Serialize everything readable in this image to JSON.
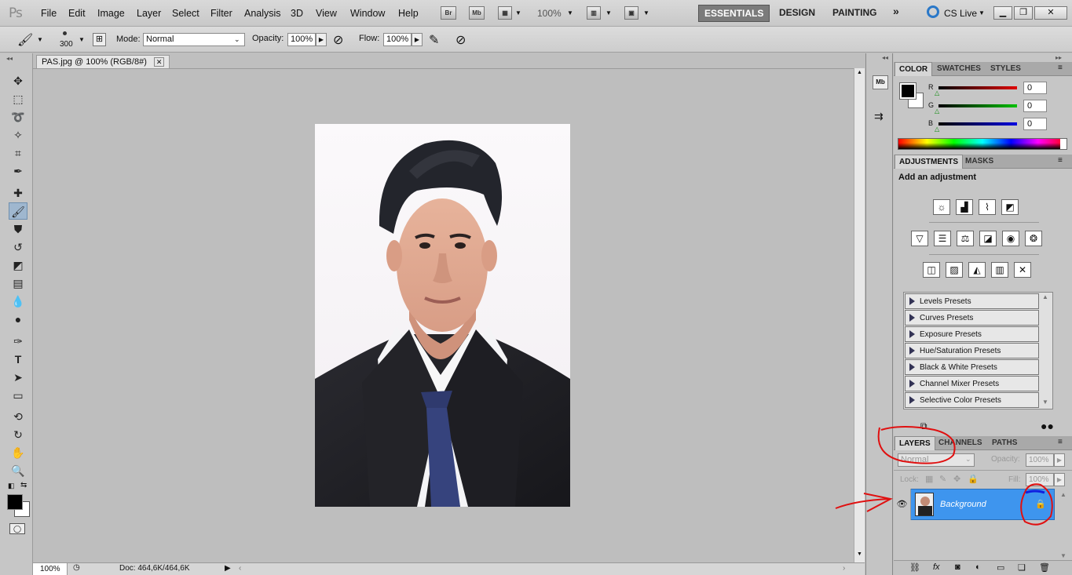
{
  "menubar": {
    "logo": "Ps",
    "items": [
      "File",
      "Edit",
      "Image",
      "Layer",
      "Select",
      "Filter",
      "Analysis",
      "3D",
      "View",
      "Window",
      "Help"
    ],
    "bridge": "Br",
    "minibridge": "Mb",
    "zoom": "100%",
    "workspaces": [
      "ESSENTIALS",
      "DESIGN",
      "PAINTING"
    ],
    "more": "»",
    "cslive": "CS Live"
  },
  "options": {
    "brush_size": "300",
    "mode_label": "Mode:",
    "mode_value": "Normal",
    "opacity_label": "Opacity:",
    "opacity_value": "100%",
    "flow_label": "Flow:",
    "flow_value": "100%"
  },
  "document": {
    "tab_title": "PAS.jpg @ 100% (RGB/8#)",
    "zoom": "100%",
    "doc_info": "Doc: 464,6K/464,6K"
  },
  "color_panel": {
    "tabs": [
      "COLOR",
      "SWATCHES",
      "STYLES"
    ],
    "channels": [
      {
        "label": "R",
        "value": "0",
        "color": "#d00000"
      },
      {
        "label": "G",
        "value": "0",
        "color": "#00b000"
      },
      {
        "label": "B",
        "value": "0",
        "color": "#0000d0"
      }
    ]
  },
  "adjustments_panel": {
    "tabs": [
      "ADJUSTMENTS",
      "MASKS"
    ],
    "heading": "Add an adjustment",
    "presets": [
      "Levels Presets",
      "Curves Presets",
      "Exposure Presets",
      "Hue/Saturation Presets",
      "Black & White Presets",
      "Channel Mixer Presets",
      "Selective Color Presets"
    ]
  },
  "layers_panel": {
    "tabs": [
      "LAYERS",
      "CHANNELS",
      "PATHS"
    ],
    "blend_mode": "Normal",
    "opacity_label": "Opacity:",
    "opacity_value": "100%",
    "lock_label": "Lock:",
    "fill_label": "Fill:",
    "fill_value": "100%",
    "layer_name": "Background"
  },
  "colors": {
    "accent": "#3b8cf0",
    "annotation": "#e01010",
    "layer_selected": "#3e95ee"
  }
}
